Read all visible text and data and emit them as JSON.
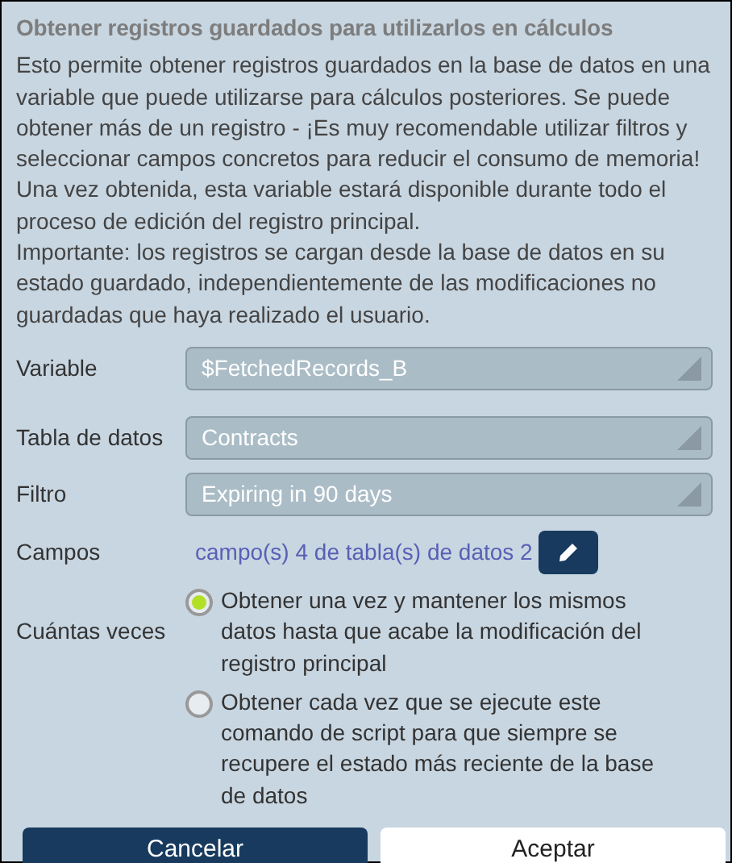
{
  "dialog": {
    "title": "Obtener registros guardados para utilizarlos en cálculos",
    "description": [
      "Esto permite obtener registros guardados en la base de datos en una variable que puede utilizarse para cálculos posteriores. Se puede obtener más de un registro - ¡Es muy recomendable utilizar filtros y seleccionar campos concretos para reducir el consumo de memoria! Una vez obtenida, esta variable estará disponible durante todo el proceso de edición del registro principal.",
      "Importante: los registros se cargan desde la base de datos en su estado guardado, independientemente de las modificaciones no guardadas que haya realizado el usuario."
    ],
    "fields": [
      {
        "kind": "select",
        "label": "Variable",
        "value": "$FetchedRecords_B"
      },
      {
        "kind": "select",
        "label": "Tabla de datos",
        "value": "Contracts"
      },
      {
        "kind": "select",
        "label": "Filtro",
        "value": "Expiring in 90 days"
      },
      {
        "kind": "link",
        "label": "Campos",
        "value": "campo(s) 4 de tabla(s) de datos 2"
      },
      {
        "kind": "radio",
        "label": "Cuántas veces",
        "options": [
          {
            "label": "Obtener una vez y mantener los mismos datos hasta que acabe la modificación del registro principal",
            "selected": true
          },
          {
            "label": "Obtener cada vez que se ejecute este comando de script para que siempre se recupere el estado más reciente de la base de datos",
            "selected": false
          }
        ]
      }
    ],
    "buttons": [
      {
        "label": "Cancelar",
        "kind": "secondary"
      },
      {
        "label": "Aceptar",
        "kind": "primary"
      }
    ]
  }
}
